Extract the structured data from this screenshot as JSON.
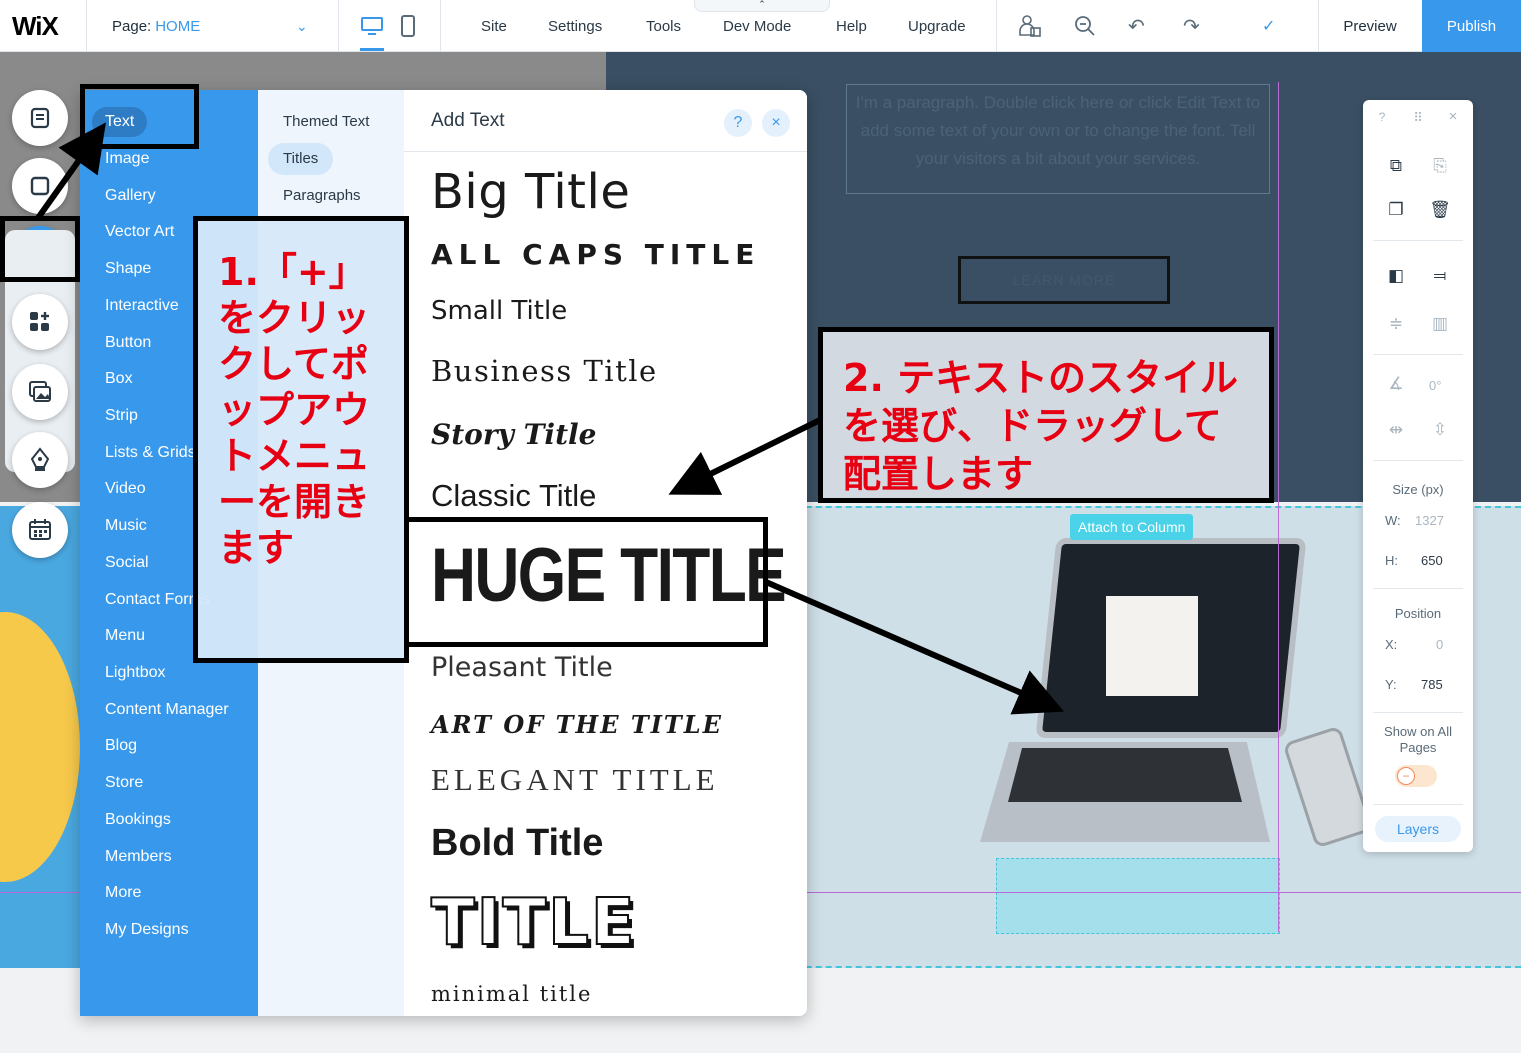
{
  "topbar": {
    "logo": "WiX",
    "page_label": "Page:",
    "page_value": "HOME",
    "menu": [
      "Site",
      "Settings",
      "Tools",
      "Dev Mode",
      "Help",
      "Upgrade"
    ],
    "preview": "Preview",
    "publish": "Publish",
    "devmode_caret": "⌃"
  },
  "site": {
    "paragraph": "I'm a paragraph. Double click here or click Edit Text to add some text of your own or to change the font. Tell your visitors a bit about your services.",
    "learn_more": "LEARN MORE",
    "attach_label": "Attach to Column"
  },
  "add_panel": {
    "categories": [
      "Text",
      "Image",
      "Gallery",
      "Vector Art",
      "Shape",
      "Interactive",
      "Button",
      "Box",
      "Strip",
      "Lists & Grids",
      "Video",
      "Music",
      "Social",
      "Contact Forms",
      "Menu",
      "Lightbox",
      "Content Manager",
      "Blog",
      "Store",
      "Bookings",
      "Members",
      "More",
      "My Designs"
    ],
    "selected_category": "Text",
    "subcategories": [
      "Themed Text",
      "Titles",
      "Paragraphs"
    ],
    "selected_subcategory": "Titles",
    "title": "Add Text",
    "help": "?",
    "close": "×",
    "presets": {
      "big": "Big Title",
      "caps": "ALL CAPS TITLE",
      "small": "Small Title",
      "business": "Business Title",
      "story": "Story Title",
      "classic": "Classic Title",
      "huge": "HUGE TITLE",
      "pleasant": "Pleasant Title",
      "art": "ART OF THE TITLE",
      "elegant": "ELEGANT TITLE",
      "bold": "Bold Title",
      "title": "TITLE",
      "minimal": "minimal title"
    }
  },
  "right_toolbar": {
    "help": "?",
    "drag": "⠿",
    "close": "×",
    "rotation": "0°",
    "size_label": "Size (px)",
    "w_label": "W:",
    "w_value": "1327",
    "h_label": "H:",
    "h_value": "650",
    "position_label": "Position",
    "x_label": "X:",
    "x_value": "0",
    "y_label": "Y:",
    "y_value": "785",
    "show_all_pages": "Show on All Pages",
    "layers": "Layers"
  },
  "annotations": {
    "step1": "1.「+」をクリックしてポップアウトメニューを開きます",
    "step2": "2. テキストのスタイルを選び、ドラッグして配置します"
  },
  "colors": {
    "accent": "#3899ec",
    "annotation_text": "#e60012"
  }
}
